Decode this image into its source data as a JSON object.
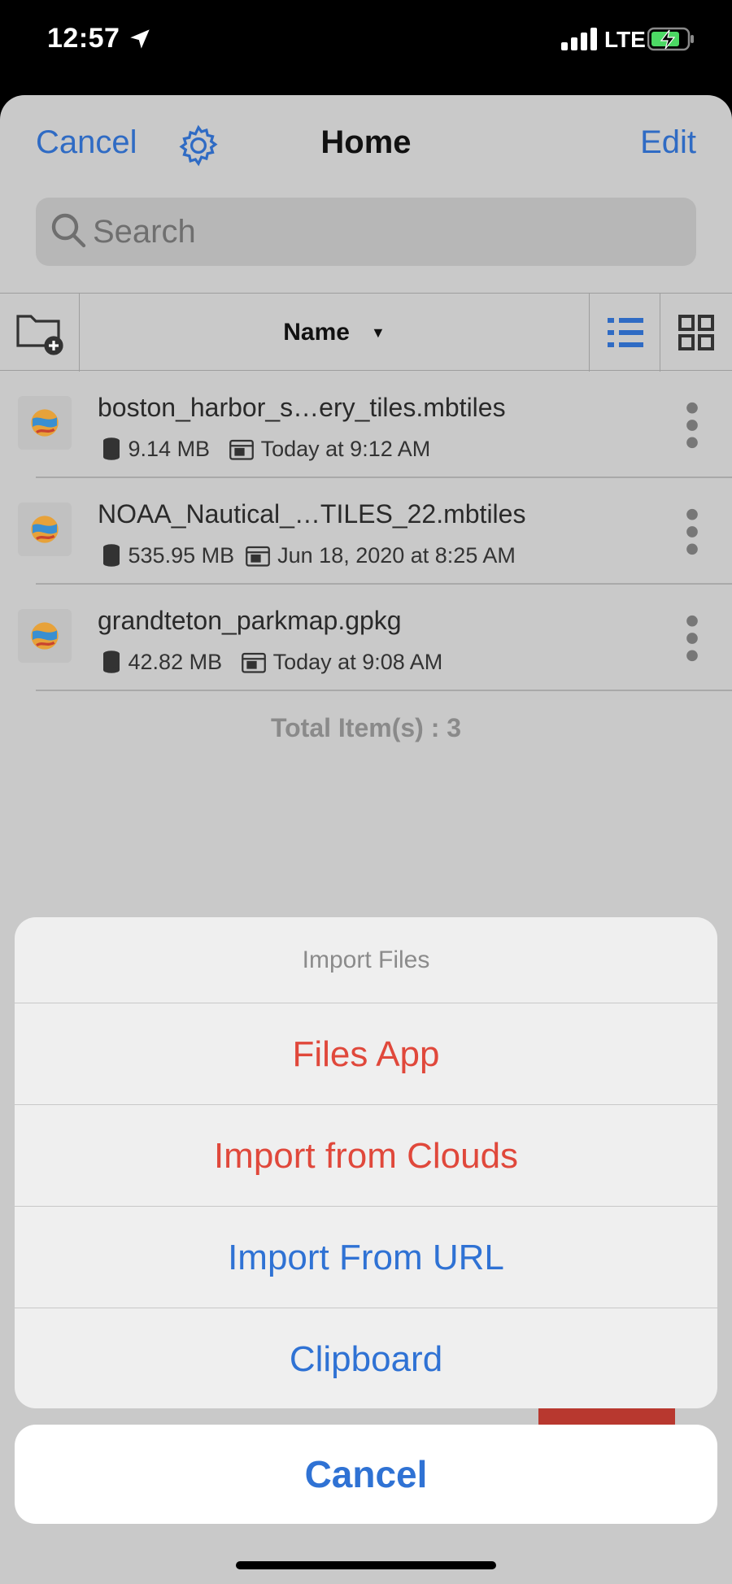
{
  "status_bar": {
    "time": "12:57",
    "network": "LTE",
    "icons": [
      "location-arrow-icon",
      "signal-bars-icon",
      "battery-charging-icon"
    ]
  },
  "nav": {
    "cancel_label": "Cancel",
    "title": "Home",
    "edit_label": "Edit",
    "accent_color": "#2f6bc4"
  },
  "search": {
    "placeholder": "Search"
  },
  "toolbar": {
    "sort_label": "Name",
    "sort_arrow": "▼",
    "view_mode": "list"
  },
  "files": [
    {
      "name": "boston_harbor_s…ery_tiles.mbtiles",
      "size": "9.14 MB",
      "date": "Today at 9:12 AM"
    },
    {
      "name": "NOAA_Nautical_…TILES_22.mbtiles",
      "size": "535.95 MB",
      "date": "Jun 18, 2020 at 8:25 AM"
    },
    {
      "name": "grandteton_parkmap.gpkg",
      "size": "42.82 MB",
      "date": "Today at 9:08 AM"
    }
  ],
  "total_label": "Total Item(s) : 3",
  "action_sheet": {
    "title": "Import Files",
    "items": [
      {
        "label": "Files App",
        "color": "#e0483b"
      },
      {
        "label": "Import from Clouds",
        "color": "#e0483b"
      },
      {
        "label": "Import From URL",
        "color": "#2f72d4"
      },
      {
        "label": "Clipboard",
        "color": "#2f72d4"
      }
    ],
    "cancel_label": "Cancel"
  }
}
